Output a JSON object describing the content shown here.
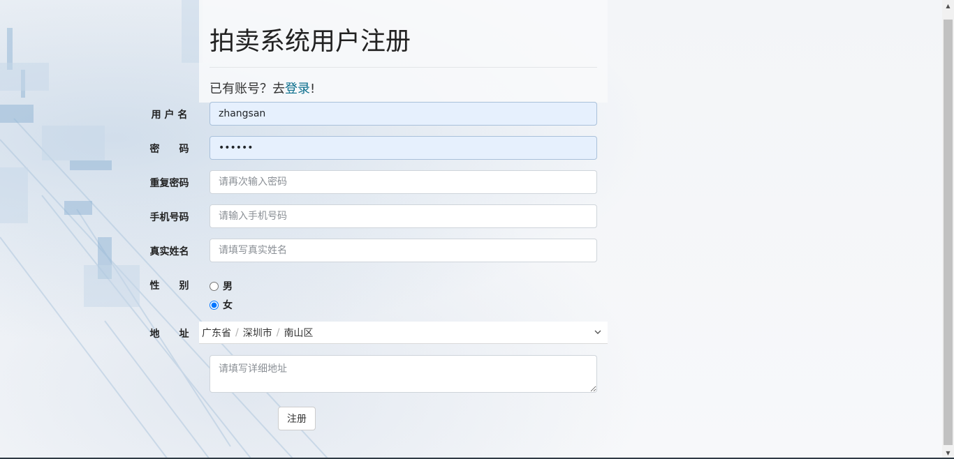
{
  "page": {
    "title": "拍卖系统用户注册",
    "login_prompt": "已有账号？去",
    "login_link": "登录",
    "login_suffix": "!"
  },
  "form": {
    "username": {
      "label": "用 户 名",
      "value": "zhangsan"
    },
    "password": {
      "label": "密　　码",
      "value": "••••••"
    },
    "confirm_password": {
      "label": "重复密码",
      "placeholder": "请再次输入密码"
    },
    "phone": {
      "label": "手机号码",
      "placeholder": "请输入手机号码"
    },
    "real_name": {
      "label": "真实姓名",
      "placeholder": "请填写真实姓名"
    },
    "gender": {
      "label": "性　　别",
      "options": [
        "男",
        "女"
      ],
      "selected": "女"
    },
    "address": {
      "label": "地　　址",
      "province": "广东省",
      "city": "深圳市",
      "district": "南山区",
      "separator": "/",
      "detail_placeholder": "请填写详细地址"
    },
    "submit_label": "注册"
  }
}
